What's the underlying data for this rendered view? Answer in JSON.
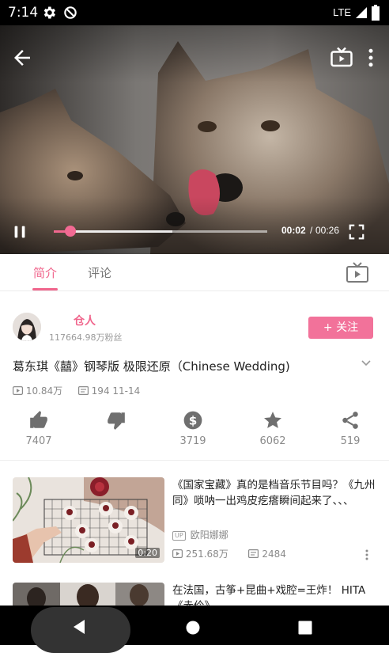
{
  "status_bar": {
    "time": "7:14",
    "network": "LTE",
    "icons": [
      "gear-icon",
      "do-not-disturb-icon",
      "signal-icon",
      "battery-icon"
    ]
  },
  "player": {
    "progress": 0.077,
    "buffered": 0.556,
    "current_time": "00:02",
    "separator": "/",
    "duration": "00:26",
    "icons": [
      "back-arrow-icon",
      "tv-cast-icon",
      "more-vertical-icon",
      "pause-icon",
      "fullscreen-icon"
    ]
  },
  "tabs": [
    {
      "label": "简介",
      "active": true
    },
    {
      "label": "评论",
      "active": false
    }
  ],
  "author": {
    "name": "仓人",
    "fans": "117664.98万粉丝",
    "follow_label": "+ 关注"
  },
  "video": {
    "title": "葛东琪《囍》钢琴版 极限还原（Chinese Wedding)",
    "plays": "10.84万",
    "date": "194 11-14"
  },
  "actions": [
    {
      "icon": "thumbs-up-icon",
      "count": "7407"
    },
    {
      "icon": "thumbs-down-icon",
      "count": ""
    },
    {
      "icon": "coin-icon",
      "count": "3719"
    },
    {
      "icon": "star-icon",
      "count": "6062"
    },
    {
      "icon": "share-icon",
      "count": "519"
    }
  ],
  "related": [
    {
      "title": "《国家宝藏》真的是档音乐节目吗？《九州同》唢呐一出鸡皮疙瘩瞬间起来了、、、",
      "up_badge": "UP",
      "uploader": "欧阳娜娜",
      "duration": "0:20",
      "plays": "251.68万",
      "danmaku": "2484"
    },
    {
      "title": "在法国，古筝+昆曲+戏腔=王炸！ HITA《赤伶》",
      "up_badge": "",
      "uploader": "",
      "duration": "",
      "plays": "",
      "danmaku": ""
    }
  ],
  "colors": {
    "accent": "#f0658c",
    "text_primary": "#222222",
    "text_secondary": "#8a8a8a",
    "icon_gray": "#6f6f6f"
  }
}
